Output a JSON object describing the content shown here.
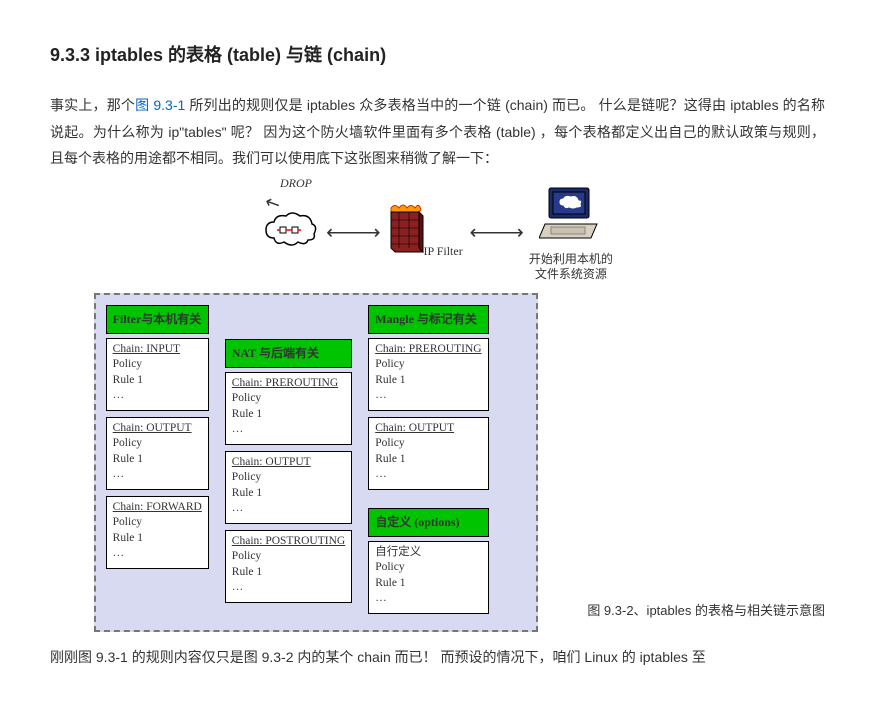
{
  "heading": "9.3.3 iptables 的表格 (table) 与链 (chain)",
  "para1_a": "事实上，那个",
  "figlink": "图 9.3-1",
  "para1_b": " 所列出的规则仅是 iptables 众多表格当中的一个链 (chain) 而已。 什么是链呢？这得由 iptables 的名称说起。为什么称为 ip\"tables\" 呢？ 因为这个防火墙软件里面有多个表格 (table) ，每个表格都定义出自己的默认政策与规则， 且每个表格的用途都不相同。我们可以使用底下这张图来稍微了解一下：",
  "drop": "DROP",
  "ipfilter": "IP Filter",
  "computer_sub1": "开始利用本机的",
  "computer_sub2": "文件系统资源",
  "filter_title": "Filter与本机有关",
  "nat_title": "NAT 与后端有关",
  "mangle_title": "Mangle 与标记有关",
  "custom_title": "自定义 (options)",
  "chain_input": "Chain: INPUT",
  "chain_output": "Chain: OUTPUT",
  "chain_forward": "Chain: FORWARD",
  "chain_pre": "Chain: PREROUTING",
  "chain_post": "Chain: POSTROUTING",
  "policy": "Policy",
  "rule1": "Rule 1",
  "dots": "…",
  "custom_line": "自行定义",
  "caption": "图 9.3-2、iptables 的表格与相关链示意图",
  "para2": "刚刚图 9.3-1 的规则内容仅只是图 9.3-2 内的某个 chain 而已！ 而预设的情况下，咱们 Linux 的 iptables 至"
}
